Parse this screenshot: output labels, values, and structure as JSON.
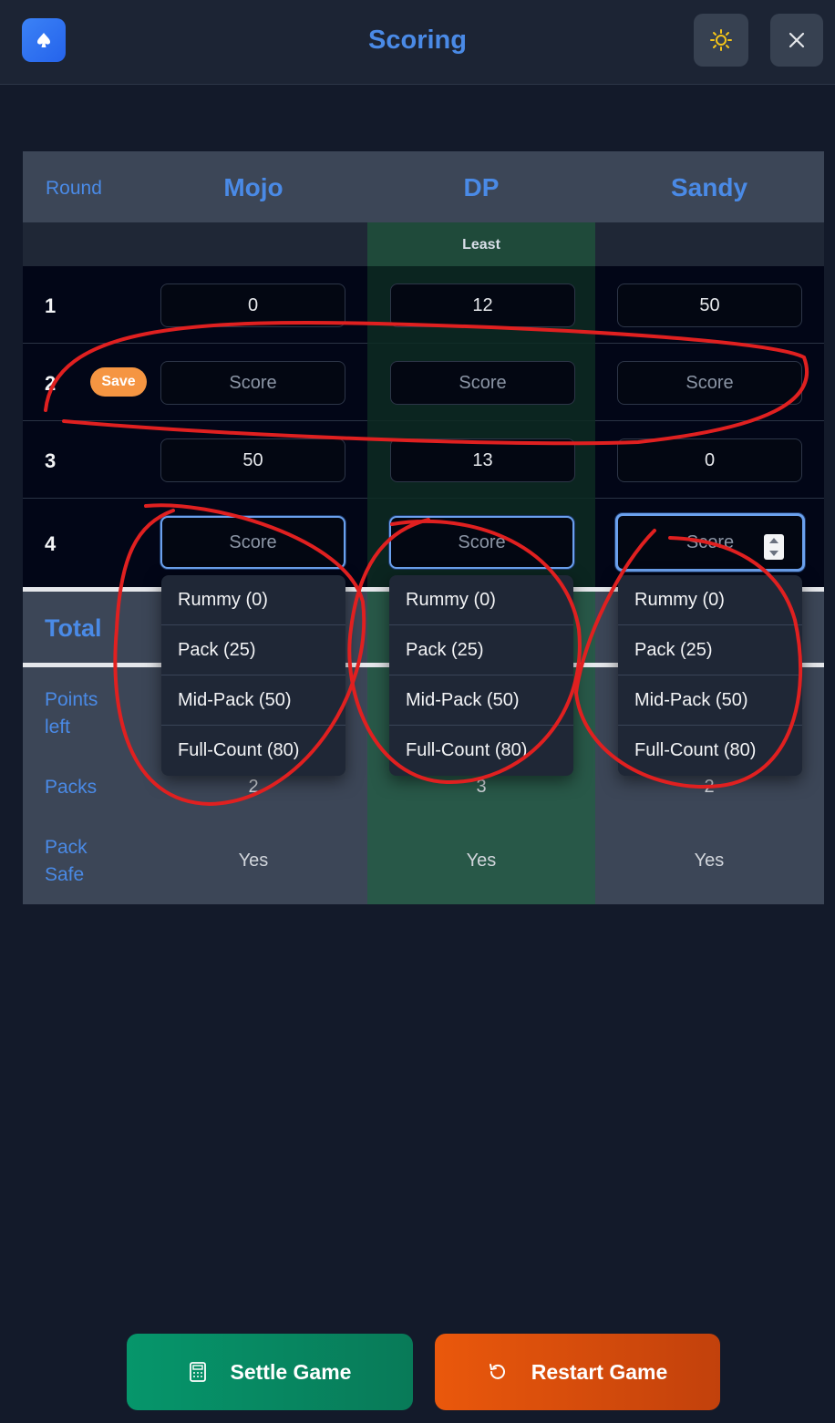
{
  "header": {
    "title": "Scoring"
  },
  "table": {
    "round_header": "Round",
    "players": [
      {
        "name": "Mojo",
        "badge": ""
      },
      {
        "name": "DP",
        "badge": "Least"
      },
      {
        "name": "Sandy",
        "badge": ""
      }
    ],
    "rounds": [
      {
        "number": "1",
        "scores": [
          "0",
          "12",
          "50"
        ]
      },
      {
        "number": "2",
        "save_label": "Save",
        "placeholders": [
          "Score",
          "Score",
          "Score"
        ]
      },
      {
        "number": "3",
        "scores": [
          "50",
          "13",
          "0"
        ]
      },
      {
        "number": "4",
        "placeholders": [
          "Score",
          "Score",
          "Score"
        ]
      }
    ],
    "total_label": "Total",
    "points_left_label": "Points left",
    "packs_label": "Packs",
    "packs": [
      "2",
      "3",
      "2"
    ],
    "pack_safe_label": "Pack Safe",
    "pack_safe": [
      "Yes",
      "Yes",
      "Yes"
    ]
  },
  "dropdown_options": [
    "Rummy (0)",
    "Pack (25)",
    "Mid-Pack (50)",
    "Full-Count (80)"
  ],
  "footer": {
    "settle_label": "Settle Game",
    "restart_label": "Restart Game"
  },
  "colors": {
    "accent": "#4a8ae6",
    "least_column": "#285848",
    "save_badge": "#f59542",
    "settle": "#06966b",
    "restart": "#ea580c",
    "annotation": "#e02020"
  },
  "icons": [
    "spade-icon",
    "sun-icon",
    "close-icon",
    "calculator-icon",
    "restart-icon"
  ]
}
